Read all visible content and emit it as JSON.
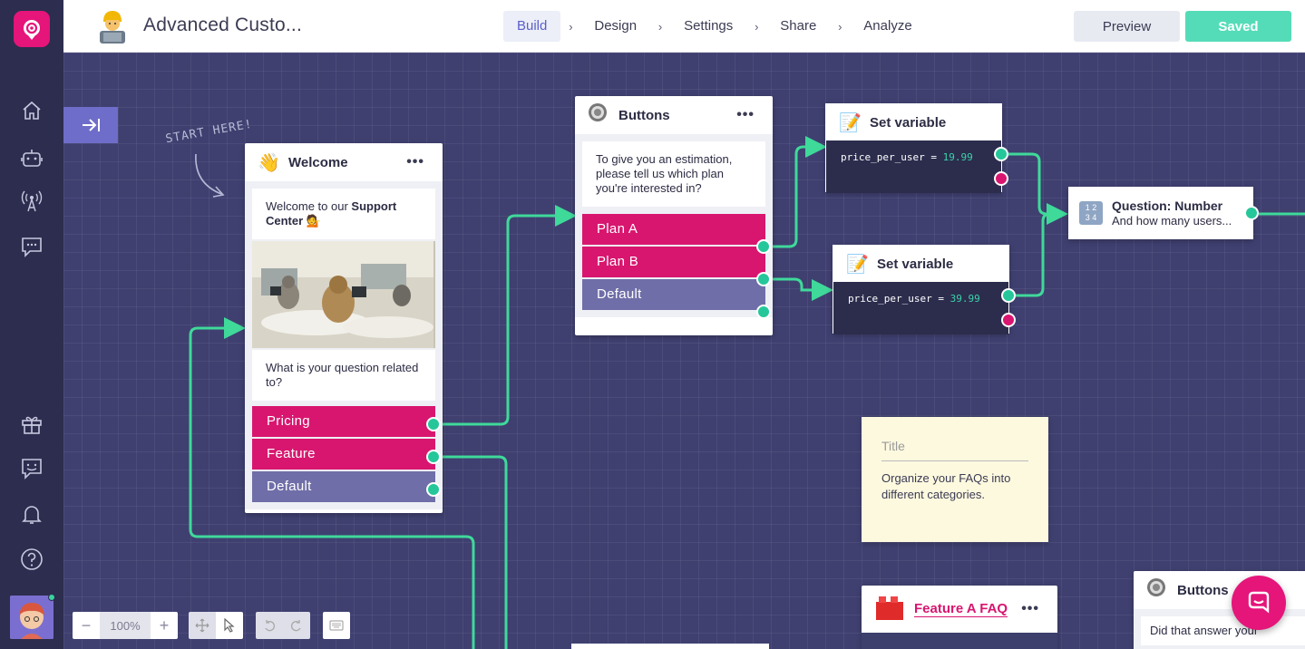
{
  "app": {
    "bot_name": "Advanced Custo..."
  },
  "nav": {
    "tabs": [
      "Build",
      "Design",
      "Settings",
      "Share",
      "Analyze"
    ],
    "active": "Build",
    "separator": "›"
  },
  "actions": {
    "preview": "Preview",
    "saved": "Saved"
  },
  "canvas": {
    "start_here": "START HERE!",
    "welcome": {
      "title": "Welcome",
      "menu": "•••",
      "message_prefix": "Welcome to our ",
      "message_bold": "Support Center",
      "message_emoji": "💁",
      "question": "What is your question related to?",
      "options": [
        "Pricing",
        "Feature",
        "Default"
      ]
    },
    "buttons1": {
      "title": "Buttons",
      "menu": "•••",
      "message": "To give you an estimation, please tell us which plan you're interested in?",
      "options": [
        "Plan A",
        "Plan B",
        "Default"
      ]
    },
    "setvar1": {
      "title": "Set variable",
      "var": "price_per_user",
      "eq": " = ",
      "value": "19.99"
    },
    "setvar2": {
      "title": "Set variable",
      "var": "price_per_user",
      "eq": " = ",
      "value": "39.99"
    },
    "question_number": {
      "title": "Question: Number",
      "subtitle": "And how many users..."
    },
    "sticky": {
      "title": "Title",
      "text": "Organize your FAQs into different categories."
    },
    "feature_faq": {
      "title": "Feature A FAQ",
      "menu": "•••"
    },
    "buttons2": {
      "title": "Buttons",
      "message": "Did that answer your"
    },
    "zoom": {
      "minus": "−",
      "value": "100%",
      "plus": "+"
    }
  },
  "colors": {
    "accent": "#e5157a",
    "option_pink": "#d8166f",
    "option_grey": "#6f6ea8",
    "port_green": "#25c79a",
    "wire": "#3fd99a",
    "canvas": "#3f4070"
  }
}
